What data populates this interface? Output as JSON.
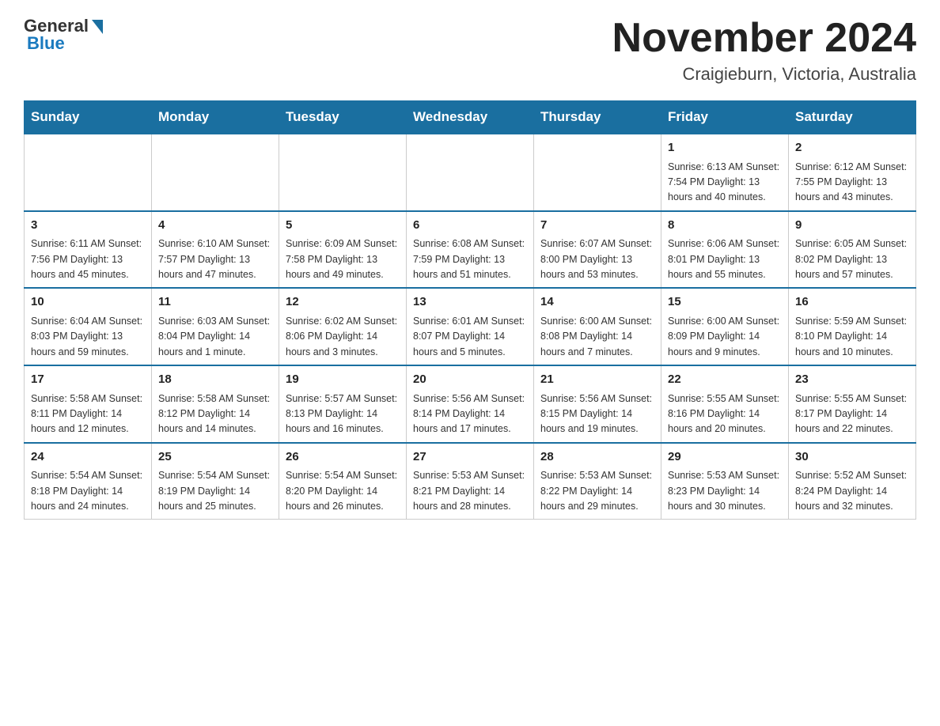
{
  "header": {
    "logo_general": "General",
    "logo_blue": "Blue",
    "month_title": "November 2024",
    "location": "Craigieburn, Victoria, Australia"
  },
  "calendar": {
    "days_of_week": [
      "Sunday",
      "Monday",
      "Tuesday",
      "Wednesday",
      "Thursday",
      "Friday",
      "Saturday"
    ],
    "weeks": [
      [
        {
          "day": "",
          "info": ""
        },
        {
          "day": "",
          "info": ""
        },
        {
          "day": "",
          "info": ""
        },
        {
          "day": "",
          "info": ""
        },
        {
          "day": "",
          "info": ""
        },
        {
          "day": "1",
          "info": "Sunrise: 6:13 AM\nSunset: 7:54 PM\nDaylight: 13 hours and 40 minutes."
        },
        {
          "day": "2",
          "info": "Sunrise: 6:12 AM\nSunset: 7:55 PM\nDaylight: 13 hours and 43 minutes."
        }
      ],
      [
        {
          "day": "3",
          "info": "Sunrise: 6:11 AM\nSunset: 7:56 PM\nDaylight: 13 hours and 45 minutes."
        },
        {
          "day": "4",
          "info": "Sunrise: 6:10 AM\nSunset: 7:57 PM\nDaylight: 13 hours and 47 minutes."
        },
        {
          "day": "5",
          "info": "Sunrise: 6:09 AM\nSunset: 7:58 PM\nDaylight: 13 hours and 49 minutes."
        },
        {
          "day": "6",
          "info": "Sunrise: 6:08 AM\nSunset: 7:59 PM\nDaylight: 13 hours and 51 minutes."
        },
        {
          "day": "7",
          "info": "Sunrise: 6:07 AM\nSunset: 8:00 PM\nDaylight: 13 hours and 53 minutes."
        },
        {
          "day": "8",
          "info": "Sunrise: 6:06 AM\nSunset: 8:01 PM\nDaylight: 13 hours and 55 minutes."
        },
        {
          "day": "9",
          "info": "Sunrise: 6:05 AM\nSunset: 8:02 PM\nDaylight: 13 hours and 57 minutes."
        }
      ],
      [
        {
          "day": "10",
          "info": "Sunrise: 6:04 AM\nSunset: 8:03 PM\nDaylight: 13 hours and 59 minutes."
        },
        {
          "day": "11",
          "info": "Sunrise: 6:03 AM\nSunset: 8:04 PM\nDaylight: 14 hours and 1 minute."
        },
        {
          "day": "12",
          "info": "Sunrise: 6:02 AM\nSunset: 8:06 PM\nDaylight: 14 hours and 3 minutes."
        },
        {
          "day": "13",
          "info": "Sunrise: 6:01 AM\nSunset: 8:07 PM\nDaylight: 14 hours and 5 minutes."
        },
        {
          "day": "14",
          "info": "Sunrise: 6:00 AM\nSunset: 8:08 PM\nDaylight: 14 hours and 7 minutes."
        },
        {
          "day": "15",
          "info": "Sunrise: 6:00 AM\nSunset: 8:09 PM\nDaylight: 14 hours and 9 minutes."
        },
        {
          "day": "16",
          "info": "Sunrise: 5:59 AM\nSunset: 8:10 PM\nDaylight: 14 hours and 10 minutes."
        }
      ],
      [
        {
          "day": "17",
          "info": "Sunrise: 5:58 AM\nSunset: 8:11 PM\nDaylight: 14 hours and 12 minutes."
        },
        {
          "day": "18",
          "info": "Sunrise: 5:58 AM\nSunset: 8:12 PM\nDaylight: 14 hours and 14 minutes."
        },
        {
          "day": "19",
          "info": "Sunrise: 5:57 AM\nSunset: 8:13 PM\nDaylight: 14 hours and 16 minutes."
        },
        {
          "day": "20",
          "info": "Sunrise: 5:56 AM\nSunset: 8:14 PM\nDaylight: 14 hours and 17 minutes."
        },
        {
          "day": "21",
          "info": "Sunrise: 5:56 AM\nSunset: 8:15 PM\nDaylight: 14 hours and 19 minutes."
        },
        {
          "day": "22",
          "info": "Sunrise: 5:55 AM\nSunset: 8:16 PM\nDaylight: 14 hours and 20 minutes."
        },
        {
          "day": "23",
          "info": "Sunrise: 5:55 AM\nSunset: 8:17 PM\nDaylight: 14 hours and 22 minutes."
        }
      ],
      [
        {
          "day": "24",
          "info": "Sunrise: 5:54 AM\nSunset: 8:18 PM\nDaylight: 14 hours and 24 minutes."
        },
        {
          "day": "25",
          "info": "Sunrise: 5:54 AM\nSunset: 8:19 PM\nDaylight: 14 hours and 25 minutes."
        },
        {
          "day": "26",
          "info": "Sunrise: 5:54 AM\nSunset: 8:20 PM\nDaylight: 14 hours and 26 minutes."
        },
        {
          "day": "27",
          "info": "Sunrise: 5:53 AM\nSunset: 8:21 PM\nDaylight: 14 hours and 28 minutes."
        },
        {
          "day": "28",
          "info": "Sunrise: 5:53 AM\nSunset: 8:22 PM\nDaylight: 14 hours and 29 minutes."
        },
        {
          "day": "29",
          "info": "Sunrise: 5:53 AM\nSunset: 8:23 PM\nDaylight: 14 hours and 30 minutes."
        },
        {
          "day": "30",
          "info": "Sunrise: 5:52 AM\nSunset: 8:24 PM\nDaylight: 14 hours and 32 minutes."
        }
      ]
    ]
  }
}
